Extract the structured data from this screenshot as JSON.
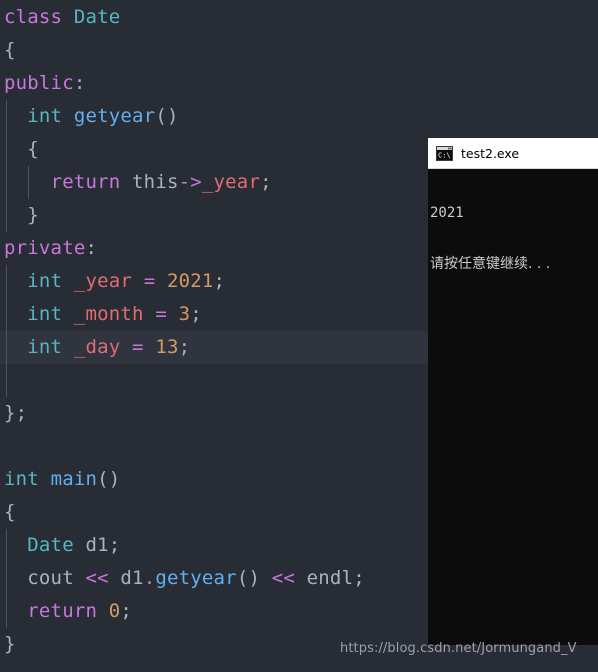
{
  "editor": {
    "background_color": "#282c34",
    "current_line_color": "#2f343e",
    "indent_guide_color": "#4b5263",
    "lines": [
      {
        "n": 1,
        "tokens": [
          {
            "t": "class ",
            "c": "kw"
          },
          {
            "t": "Date",
            "c": "type"
          }
        ]
      },
      {
        "n": 2,
        "tokens": [
          {
            "t": "{",
            "c": "pun"
          }
        ]
      },
      {
        "n": 3,
        "tokens": [
          {
            "t": "public",
            "c": "kw"
          },
          {
            "t": ":",
            "c": "pun"
          }
        ]
      },
      {
        "n": 4,
        "tokens": [
          {
            "t": "  ",
            "c": "plain"
          },
          {
            "t": "int",
            "c": "type"
          },
          {
            "t": " ",
            "c": "plain"
          },
          {
            "t": "getyear",
            "c": "fn"
          },
          {
            "t": "()",
            "c": "pun"
          }
        ]
      },
      {
        "n": 5,
        "tokens": [
          {
            "t": "  ",
            "c": "plain"
          },
          {
            "t": "{",
            "c": "pun"
          }
        ]
      },
      {
        "n": 6,
        "tokens": [
          {
            "t": "    ",
            "c": "plain"
          },
          {
            "t": "return",
            "c": "kw"
          },
          {
            "t": " ",
            "c": "plain"
          },
          {
            "t": "this",
            "c": "plain"
          },
          {
            "t": "->",
            "c": "op"
          },
          {
            "t": "_year",
            "c": "var"
          },
          {
            "t": ";",
            "c": "pun"
          }
        ]
      },
      {
        "n": 7,
        "tokens": [
          {
            "t": "  ",
            "c": "plain"
          },
          {
            "t": "}",
            "c": "pun"
          }
        ]
      },
      {
        "n": 8,
        "tokens": [
          {
            "t": "private",
            "c": "kw"
          },
          {
            "t": ":",
            "c": "pun"
          }
        ]
      },
      {
        "n": 9,
        "tokens": [
          {
            "t": "  ",
            "c": "plain"
          },
          {
            "t": "int",
            "c": "type"
          },
          {
            "t": " ",
            "c": "plain"
          },
          {
            "t": "_year",
            "c": "var"
          },
          {
            "t": " ",
            "c": "plain"
          },
          {
            "t": "=",
            "c": "op"
          },
          {
            "t": " ",
            "c": "plain"
          },
          {
            "t": "2021",
            "c": "num"
          },
          {
            "t": ";",
            "c": "pun"
          }
        ]
      },
      {
        "n": 10,
        "tokens": [
          {
            "t": "  ",
            "c": "plain"
          },
          {
            "t": "int",
            "c": "type"
          },
          {
            "t": " ",
            "c": "plain"
          },
          {
            "t": "_month",
            "c": "var"
          },
          {
            "t": " ",
            "c": "plain"
          },
          {
            "t": "=",
            "c": "op"
          },
          {
            "t": " ",
            "c": "plain"
          },
          {
            "t": "3",
            "c": "num"
          },
          {
            "t": ";",
            "c": "pun"
          }
        ]
      },
      {
        "n": 11,
        "tokens": [
          {
            "t": "  ",
            "c": "plain"
          },
          {
            "t": "int",
            "c": "type"
          },
          {
            "t": " ",
            "c": "plain"
          },
          {
            "t": "_day",
            "c": "var"
          },
          {
            "t": " ",
            "c": "plain"
          },
          {
            "t": "=",
            "c": "op"
          },
          {
            "t": " ",
            "c": "plain"
          },
          {
            "t": "13",
            "c": "num"
          },
          {
            "t": ";",
            "c": "pun"
          }
        ],
        "current": true
      },
      {
        "n": 12,
        "tokens": []
      },
      {
        "n": 13,
        "tokens": [
          {
            "t": "};",
            "c": "pun"
          }
        ]
      },
      {
        "n": 14,
        "tokens": []
      },
      {
        "n": 15,
        "tokens": [
          {
            "t": "int",
            "c": "type"
          },
          {
            "t": " ",
            "c": "plain"
          },
          {
            "t": "main",
            "c": "fn"
          },
          {
            "t": "()",
            "c": "pun"
          }
        ]
      },
      {
        "n": 16,
        "tokens": [
          {
            "t": "{",
            "c": "pun"
          }
        ]
      },
      {
        "n": 17,
        "tokens": [
          {
            "t": "  ",
            "c": "plain"
          },
          {
            "t": "Date",
            "c": "type"
          },
          {
            "t": " ",
            "c": "plain"
          },
          {
            "t": "d1",
            "c": "plain"
          },
          {
            "t": ";",
            "c": "pun"
          }
        ]
      },
      {
        "n": 18,
        "tokens": [
          {
            "t": "  ",
            "c": "plain"
          },
          {
            "t": "cout",
            "c": "plain"
          },
          {
            "t": " ",
            "c": "plain"
          },
          {
            "t": "<<",
            "c": "op"
          },
          {
            "t": " ",
            "c": "plain"
          },
          {
            "t": "d1",
            "c": "plain"
          },
          {
            "t": ".",
            "c": "op"
          },
          {
            "t": "getyear",
            "c": "fn"
          },
          {
            "t": "()",
            "c": "pun"
          },
          {
            "t": " ",
            "c": "plain"
          },
          {
            "t": "<<",
            "c": "op"
          },
          {
            "t": " ",
            "c": "plain"
          },
          {
            "t": "endl",
            "c": "plain"
          },
          {
            "t": ";",
            "c": "pun"
          }
        ]
      },
      {
        "n": 19,
        "tokens": [
          {
            "t": "  ",
            "c": "plain"
          },
          {
            "t": "return",
            "c": "kw"
          },
          {
            "t": " ",
            "c": "plain"
          },
          {
            "t": "0",
            "c": "num"
          },
          {
            "t": ";",
            "c": "pun"
          }
        ]
      },
      {
        "n": 20,
        "tokens": [
          {
            "t": "}",
            "c": "pun"
          }
        ]
      }
    ],
    "plain_text": "class Date\n{\npublic:\n  int getyear()\n  {\n    return this->_year;\n  }\nprivate:\n  int _year = 2021;\n  int _month = 3;\n  int _day = 13;\n\n};\n\nint main()\n{\n  Date d1;\n  cout << d1.getyear() << endl;\n  return 0;\n}"
  },
  "console": {
    "title": "test2.exe",
    "icon": "cmd-icon",
    "background_color": "#0c0c0c",
    "titlebar_color": "#ffffff",
    "text_color": "#cccccc",
    "output_lines": [
      "2021",
      "请按任意键继续. . ."
    ],
    "output_line_1": "2021",
    "output_line_2": "请按任意键继续. . ."
  },
  "watermark": {
    "text": "https://blog.csdn.net/Jormungand_V"
  }
}
